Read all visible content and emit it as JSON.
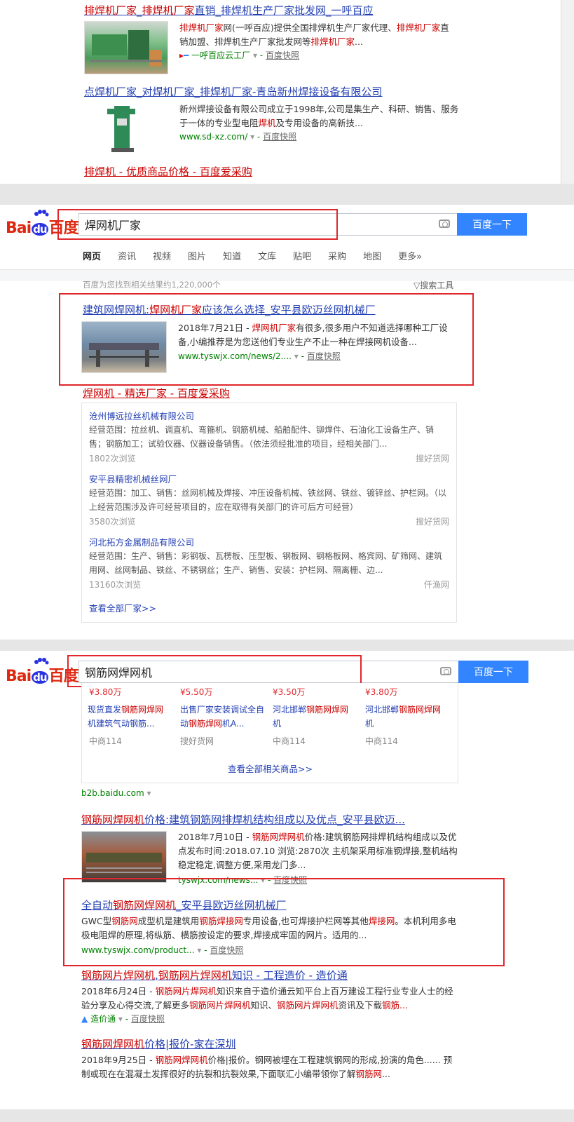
{
  "section1": {
    "results": [
      {
        "title_parts": [
          [
            "排焊机厂家",
            true
          ],
          [
            "_",
            false
          ],
          [
            "排焊机厂家",
            true
          ],
          [
            "直销_排焊机生产厂家批发网_一呼百应",
            false
          ]
        ],
        "desc_parts": [
          [
            "排焊机厂家",
            true
          ],
          [
            "网(一呼百应)提供全国排焊机生产厂家代理、",
            false
          ],
          [
            "排焊机厂家",
            true
          ],
          [
            "直销加盟、排焊机生产厂家批发网等",
            false
          ],
          [
            "排焊机厂家",
            true
          ],
          [
            "...",
            false
          ]
        ],
        "url": "一呼百应云工厂",
        "snapshot": "百度快照"
      },
      {
        "title": "点焊机厂家_对焊机厂家_排焊机厂家-青岛新州焊接设备有限公司",
        "desc_parts": [
          [
            "新州焊接设备有限公司成立于1998年,公司是集生产、科研、销售、服务于一体的专业型电阻",
            false
          ],
          [
            "焊机",
            true
          ],
          [
            "及专用设备的高新技...",
            false
          ]
        ],
        "url": "www.sd-xz.com/",
        "snapshot": "百度快照"
      }
    ],
    "ad_title": "排焊机 - 优质商品价格 - 百度爱采购"
  },
  "section2": {
    "logo": "Bai du 百度",
    "query": "焊网机厂家",
    "search_button": "百度一下",
    "tabs": [
      "网页",
      "资讯",
      "视频",
      "图片",
      "知道",
      "文库",
      "贴吧",
      "采购",
      "地图",
      "更多»"
    ],
    "result_count": "百度为您找到相关结果约1,220,000个",
    "search_tools": "搜索工具",
    "result1": {
      "title": "建筑网焊网机:焊网机厂家应该怎么选择_安平县欧迈丝网机械厂",
      "desc_parts": [
        [
          "2018年7月21日 - ",
          false
        ],
        [
          "焊网机厂家",
          true
        ],
        [
          "有很多,很多用户不知道选择哪种工厂设备,小编推荐是为您送他们专业生产不止一种在焊接网机设备...",
          false
        ]
      ],
      "url": "www.tyswjx.com/news/2....",
      "snapshot": "百度快照"
    },
    "ad_title": "焊网机 - 精选厂家 - 百度爱采购",
    "companies": [
      {
        "name": "沧州博远拉丝机械有限公司",
        "desc": "经营范围：拉丝机、调直机、弯箍机、钢筋机械、船舶配件、铆焊件、石油化工设备生产、销售；钢筋加工；试验仪器、仪器设备销售。（依法须经批准的项目，经相关部门...",
        "views": "1802次浏览",
        "source": "搜好货网"
      },
      {
        "name": "安平县精密机械丝网厂",
        "desc": "经营范围：加工、销售：丝网机械及焊接、冲压设备机械、铁丝网、铁丝、镀锌丝、护栏网。（以上经营范围涉及许可经营项目的，应在取得有关部门的许可后方可经营）",
        "views": "3580次浏览",
        "source": "搜好货网"
      },
      {
        "name": "河北拓方金属制品有限公司",
        "desc": "经营范围：生产、销售：彩钢板、瓦楞板、压型板、钢板网、钢格板网、格宾网、矿筛网、建筑用网、丝网制品、铁丝、不锈钢丝；生产、销售、安装：护栏网、隔离栅、边...",
        "views": "13160次浏览",
        "source": "仟渔网"
      }
    ],
    "view_all": "查看全部厂家>>"
  },
  "section3": {
    "query": "钢筋网焊网机",
    "search_button": "百度一下",
    "products": [
      {
        "price": "¥3.80万",
        "name_parts": [
          [
            "现货直发",
            false
          ],
          [
            "钢筋网焊网",
            true
          ],
          [
            "机建筑气动钢筋...",
            false
          ]
        ],
        "shop": "中商114"
      },
      {
        "price": "¥5.50万",
        "name_parts": [
          [
            "出售厂家安装调试全自动",
            false
          ],
          [
            "钢筋焊网",
            true
          ],
          [
            "机A...",
            false
          ]
        ],
        "shop": "搜好货网"
      },
      {
        "price": "¥3.50万",
        "name_parts": [
          [
            "河北邯郸",
            false
          ],
          [
            "钢筋网焊网",
            true
          ],
          [
            "机",
            false
          ]
        ],
        "shop": "中商114"
      },
      {
        "price": "¥3.80万",
        "name_parts": [
          [
            "河北邯郸",
            false
          ],
          [
            "钢筋网焊网",
            true
          ],
          [
            "机",
            false
          ]
        ],
        "shop": "中商114"
      }
    ],
    "view_all_products": "查看全部相关商品>>",
    "b2b": "b2b.baidu.com",
    "results": [
      {
        "title": "钢筋网焊网机价格:建筑钢筋网排焊机结构组成以及优点_安平县欧迈...",
        "desc_parts": [
          [
            "2018年7月10日 - ",
            false
          ],
          [
            "钢筋网焊网机",
            true
          ],
          [
            "价格:建筑钢筋网排焊机结构组成以及优点发布时间:2018.07.10 浏览:2870次 主机架采用标准钢焊接,整机结构稳定稳定,调整方便,采用龙门多...",
            false
          ]
        ],
        "url": "tyswjx.com/news...",
        "snapshot": "百度快照"
      },
      {
        "title": "全自动钢筋网焊网机_安平县欧迈丝网机械厂",
        "desc_parts": [
          [
            "GWC型",
            false
          ],
          [
            "钢筋网",
            true
          ],
          [
            "成型机是建筑用",
            false
          ],
          [
            "钢筋焊接网",
            true
          ],
          [
            "专用设备,也可焊接护栏网等其他",
            false
          ],
          [
            "焊接网",
            true
          ],
          [
            "。本机利用多电极电阻焊的原理,将纵筋、横筋按设定的要求,焊接成牢固的网片。适用的...",
            false
          ]
        ],
        "url": "www.tyswjx.com/product...",
        "snapshot": "百度快照"
      },
      {
        "title": "钢筋网片焊网机,钢筋网片焊网机知识 - 工程造价 - 造价通",
        "desc_parts": [
          [
            "2018年6月24日 - ",
            false
          ],
          [
            "钢筋网片焊网机",
            true
          ],
          [
            "知识来自于造价通云知平台上百万建设工程行业专业人士的经验分享及心得交流,了解更多",
            false
          ],
          [
            "钢筋网片焊网机",
            true
          ],
          [
            "知识、",
            false
          ],
          [
            "钢筋网片焊网机",
            true
          ],
          [
            "资讯及下载",
            false
          ],
          [
            "钢筋...",
            true
          ]
        ],
        "url": "造价通",
        "snapshot": "百度快照"
      },
      {
        "title": "钢筋网焊网机价格|报价-家在深圳",
        "desc_parts": [
          [
            "2018年9月25日 - ",
            false
          ],
          [
            "钢筋网焊网机",
            true
          ],
          [
            "价格|报价。钢网被埋在工程建筑钢网的形成,扮演的角色...... 预制或现在在混凝土发挥很好的抗裂和抗裂效果,下面联汇小编带领你了解",
            false
          ],
          [
            "钢筋网",
            true
          ],
          [
            "...",
            false
          ]
        ]
      }
    ]
  },
  "colors": {
    "link": "#2440b3",
    "highlight": "#cc0000",
    "url_green": "#008000",
    "button_blue": "#3385ff",
    "annotation_red": "#e0262b",
    "separator": "#e6e6e6"
  }
}
